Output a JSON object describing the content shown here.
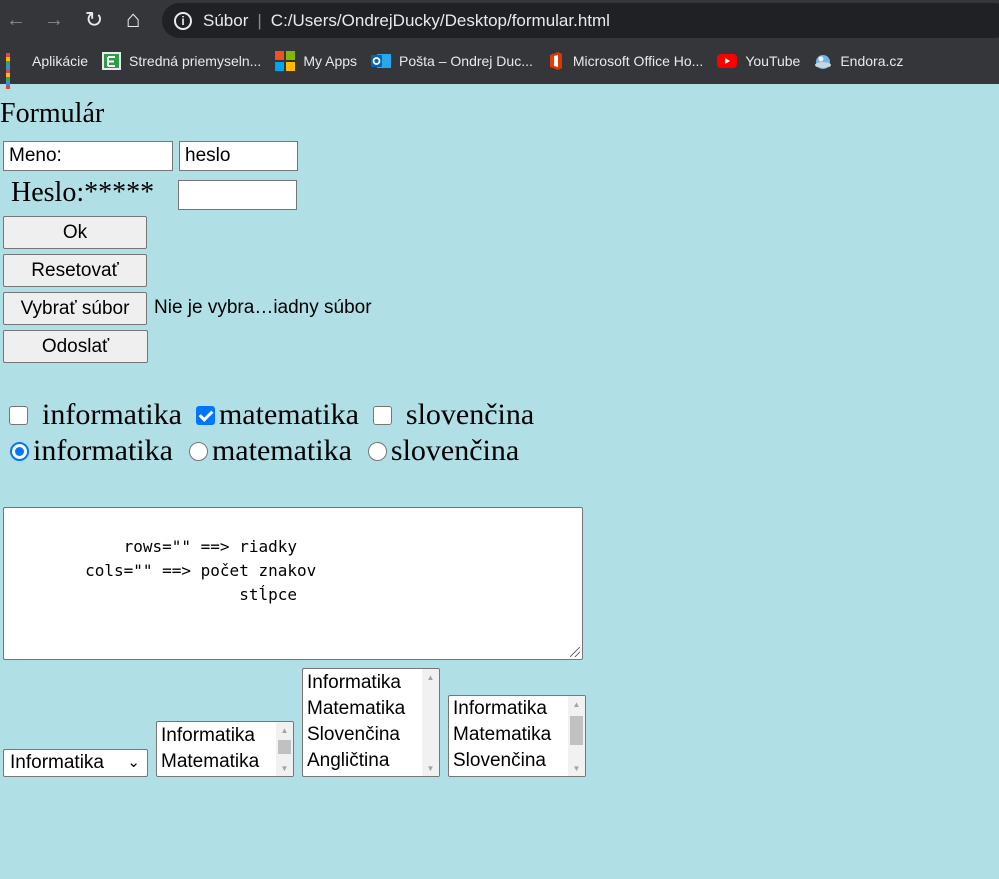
{
  "browser": {
    "nav": {
      "back_icon": "←",
      "forward_icon": "→",
      "reload_icon": "↻",
      "home_icon": "⌂"
    },
    "address": {
      "info_icon": "i",
      "scheme": "Súbor",
      "separator": "|",
      "url": "C:/Users/OndrejDucky/Desktop/formular.html"
    },
    "bookmarks": [
      {
        "label": "Aplikácie",
        "icon": "apps-grid-icon"
      },
      {
        "label": "Stredná priemyseln...",
        "icon": "school-icon"
      },
      {
        "label": "My Apps",
        "icon": "microsoft-icon"
      },
      {
        "label": "Pošta – Ondrej Duc...",
        "icon": "outlook-icon"
      },
      {
        "label": "Microsoft Office Ho...",
        "icon": "office-icon"
      },
      {
        "label": "YouTube",
        "icon": "youtube-icon"
      },
      {
        "label": "Endora.cz",
        "icon": "endora-icon"
      }
    ]
  },
  "form": {
    "heading": "Formulár",
    "name_input_value": "Meno:",
    "password_input_value": "heslo",
    "password_label": "Heslo:*****",
    "password2_input_value": "",
    "ok_button": "Ok",
    "reset_button": "Resetovať",
    "file_button": "Vybrať súbor",
    "file_status": "Nie je vybra…iadny súbor",
    "submit_button": "Odoslať",
    "checkboxes": [
      {
        "label": "informatika",
        "checked": false
      },
      {
        "label": "matematika",
        "checked": true
      },
      {
        "label": "slovenčina",
        "checked": false
      }
    ],
    "radios": [
      {
        "label": "informatika",
        "checked": true
      },
      {
        "label": "matematika",
        "checked": false
      },
      {
        "label": "slovenčina",
        "checked": false
      }
    ],
    "textarea_value": "        rows=\"\" ==> riadky\n        cols=\"\" ==> počet znakov\n                        stĺpce",
    "select_value": "Informatika",
    "select_chevron": "⌄",
    "listbox_small": [
      "Informatika",
      "Matematika"
    ],
    "listbox_large": [
      "Informatika",
      "Matematika",
      "Slovenčina",
      "Angličtina"
    ],
    "listbox_medium": [
      "Informatika",
      "Matematika",
      "Slovenčina"
    ],
    "scroll_arrows": {
      "up": "▲",
      "down": "▼"
    }
  }
}
